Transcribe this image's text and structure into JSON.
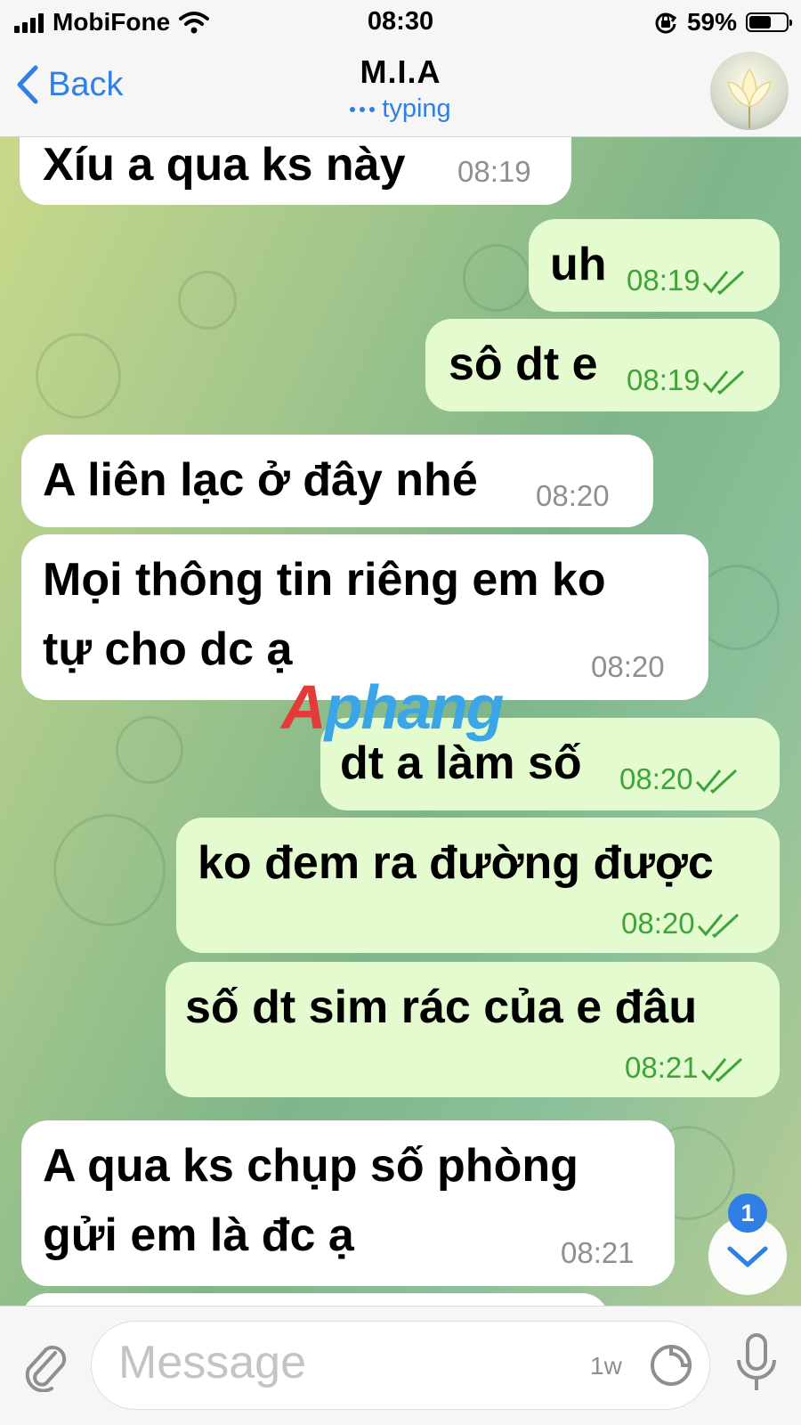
{
  "status_bar": {
    "carrier": "MobiFone",
    "time": "08:30",
    "battery_percent": "59%",
    "battery_level": 0.59,
    "icons": [
      "signal-bars-icon",
      "wifi-icon",
      "orientation-lock-icon",
      "battery-icon"
    ]
  },
  "header": {
    "back_label": "Back",
    "title": "M.I.A",
    "subtitle": "typing",
    "avatar_icon": "lotus-avatar"
  },
  "messages": [
    {
      "direction": "in",
      "lines": [
        "Xíu a qua ks này"
      ],
      "time": "08:19"
    },
    {
      "direction": "out",
      "lines": [
        "uh"
      ],
      "time": "08:19",
      "read": true
    },
    {
      "direction": "out",
      "lines": [
        "sô dt e"
      ],
      "time": "08:19",
      "read": true
    },
    {
      "direction": "in",
      "lines": [
        "A liên lạc ở đây nhé"
      ],
      "time": "08:20"
    },
    {
      "direction": "in",
      "lines": [
        "Mọi thông tin riêng em ko",
        "tự cho dc ạ"
      ],
      "time": "08:20"
    },
    {
      "direction": "out",
      "lines": [
        "dt a làm số"
      ],
      "time": "08:20",
      "read": true
    },
    {
      "direction": "out",
      "lines": [
        "ko đem ra đường được"
      ],
      "time": "08:20",
      "read": true
    },
    {
      "direction": "out",
      "lines": [
        "số dt sim rác của e đâu"
      ],
      "time": "08:21",
      "read": true
    },
    {
      "direction": "in",
      "lines": [
        "A qua ks chụp số phòng",
        "gửi em là đc ạ"
      ],
      "time": "08:21"
    }
  ],
  "watermark": {
    "part1": "A",
    "part2": "phang"
  },
  "scroll_down": {
    "unread_count": "1"
  },
  "composer": {
    "placeholder": "Message",
    "timer_label": "1w",
    "icons": [
      "paperclip-icon",
      "sticker-icon",
      "microphone-icon"
    ]
  },
  "colors": {
    "accent": "#2f7fe6",
    "outgoing_bubble": "#e4fbd0",
    "incoming_bubble": "#ffffff",
    "outgoing_time": "#3fa33a"
  }
}
